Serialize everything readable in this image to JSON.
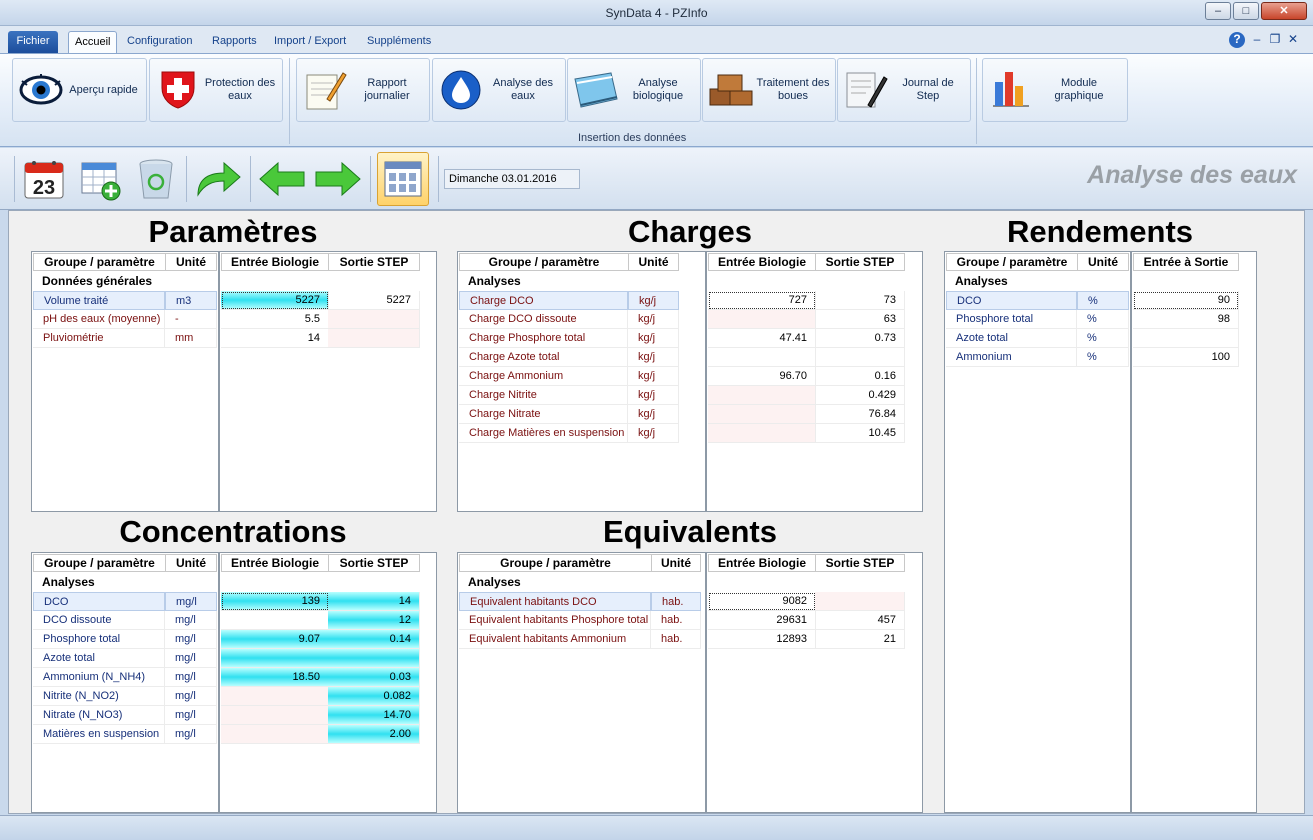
{
  "window": {
    "title": "SynData 4 - PZInfo"
  },
  "tabs": {
    "file": "Fichier",
    "accueil": "Accueil",
    "configuration": "Configuration",
    "rapports": "Rapports",
    "import_export": "Import / Export",
    "supplements": "Suppléments"
  },
  "ribbon": {
    "apercu": "Aperçu rapide",
    "protection": "Protection des eaux",
    "rapport_journalier": "Rapport journalier",
    "analyse_eaux": "Analyse des eaux",
    "analyse_bio": "Analyse biologique",
    "traitement": "Traitement des boues",
    "journal": "Journal de Step",
    "module": "Module graphique",
    "group_label": "Insertion des données"
  },
  "toolbar": {
    "calendar_day": "23",
    "date": "Dimanche 03.01.2016",
    "heading": "Analyse des eaux"
  },
  "headers": {
    "groupe": "Groupe / paramètre",
    "unite": "Unité",
    "entree_bio": "Entrée Biologie",
    "sortie_step": "Sortie STEP",
    "entree_sortie": "Entrée à Sortie"
  },
  "sections": {
    "parametres": {
      "title": "Paramètres",
      "group": "Données générales",
      "rows": [
        {
          "name": "Volume traité",
          "unit": "m3",
          "in": "5227",
          "out": "5227"
        },
        {
          "name": "pH des eaux (moyenne)",
          "unit": "-",
          "in": "5.5",
          "out": ""
        },
        {
          "name": "Pluviométrie",
          "unit": "mm",
          "in": "14",
          "out": ""
        }
      ]
    },
    "charges": {
      "title": "Charges",
      "group": "Analyses",
      "rows": [
        {
          "name": "Charge DCO",
          "unit": "kg/j",
          "in": "727",
          "out": "73"
        },
        {
          "name": "Charge DCO dissoute",
          "unit": "kg/j",
          "in": "",
          "out": "63"
        },
        {
          "name": "Charge Phosphore total",
          "unit": "kg/j",
          "in": "47.41",
          "out": "0.73"
        },
        {
          "name": "Charge Azote total",
          "unit": "kg/j",
          "in": "",
          "out": ""
        },
        {
          "name": "Charge Ammonium",
          "unit": "kg/j",
          "in": "96.70",
          "out": "0.16"
        },
        {
          "name": "Charge Nitrite",
          "unit": "kg/j",
          "in": "",
          "out": "0.429"
        },
        {
          "name": "Charge Nitrate",
          "unit": "kg/j",
          "in": "",
          "out": "76.84"
        },
        {
          "name": "Charge Matières en suspension",
          "unit": "kg/j",
          "in": "",
          "out": "10.45"
        }
      ]
    },
    "rendements": {
      "title": "Rendements",
      "group": "Analyses",
      "rows": [
        {
          "name": "DCO",
          "unit": "%",
          "val": "90"
        },
        {
          "name": "Phosphore total",
          "unit": "%",
          "val": "98"
        },
        {
          "name": "Azote total",
          "unit": "%",
          "val": ""
        },
        {
          "name": "Ammonium",
          "unit": "%",
          "val": "100"
        }
      ]
    },
    "concentrations": {
      "title": "Concentrations",
      "group": "Analyses",
      "rows": [
        {
          "name": "DCO",
          "unit": "mg/l",
          "in": "139",
          "out": "14"
        },
        {
          "name": "DCO dissoute",
          "unit": "mg/l",
          "in": "",
          "out": "12"
        },
        {
          "name": "Phosphore total",
          "unit": "mg/l",
          "in": "9.07",
          "out": "0.14"
        },
        {
          "name": "Azote total",
          "unit": "mg/l",
          "in": "",
          "out": ""
        },
        {
          "name": "Ammonium (N_NH4)",
          "unit": "mg/l",
          "in": "18.50",
          "out": "0.03"
        },
        {
          "name": "Nitrite (N_NO2)",
          "unit": "mg/l",
          "in": "",
          "out": "0.082"
        },
        {
          "name": "Nitrate (N_NO3)",
          "unit": "mg/l",
          "in": "",
          "out": "14.70"
        },
        {
          "name": "Matières en suspension",
          "unit": "mg/l",
          "in": "",
          "out": "2.00"
        }
      ]
    },
    "equivalents": {
      "title": "Equivalents",
      "group": "Analyses",
      "rows": [
        {
          "name": "Equivalent habitants DCO",
          "unit": "hab.",
          "in": "9082",
          "out": ""
        },
        {
          "name": "Equivalent habitants Phosphore total",
          "unit": "hab.",
          "in": "29631",
          "out": "457"
        },
        {
          "name": "Equivalent habitants Ammonium",
          "unit": "hab.",
          "in": "12893",
          "out": "21"
        }
      ]
    }
  }
}
